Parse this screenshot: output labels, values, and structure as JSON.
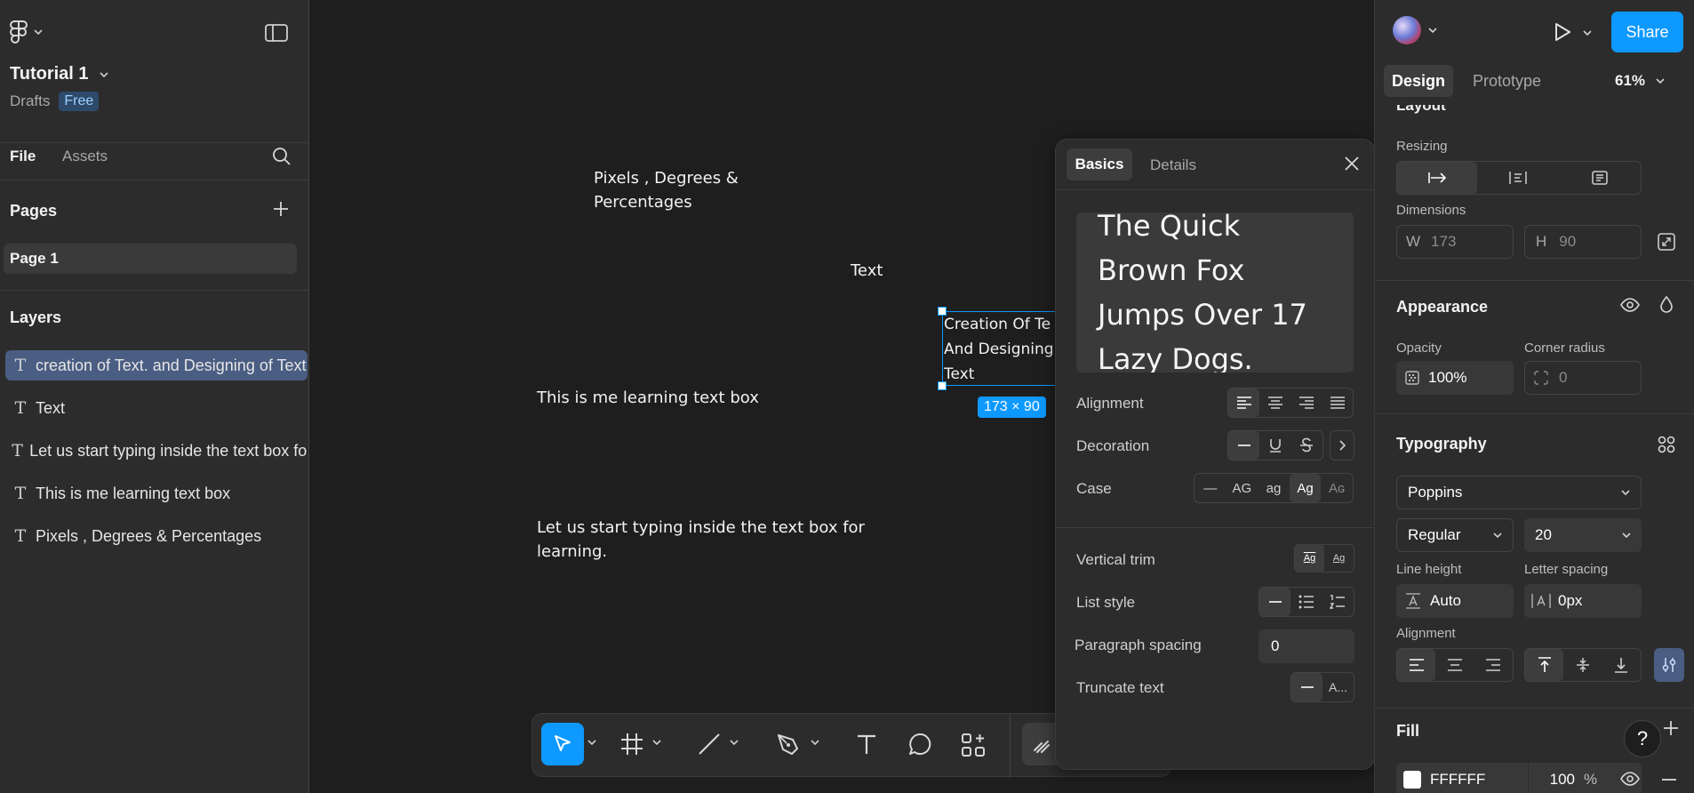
{
  "left": {
    "file_name": "Tutorial 1",
    "drafts_label": "Drafts",
    "plan_badge": "Free",
    "tabs": [
      "File",
      "Assets"
    ],
    "pages_title": "Pages",
    "pages": [
      "Page 1"
    ],
    "layers_title": "Layers",
    "layers": [
      "creation of Text. and Designing of Text",
      "Text",
      "Let us start typing inside the text box for learning.",
      "This is me learning text box",
      "Pixels , Degrees & Percentages"
    ]
  },
  "canvas": {
    "text_pixels_line1": "Pixels , Degrees &",
    "text_pixels_line2": "Percentages",
    "text_plain": "Text",
    "text_learning": "This is me learning text box",
    "text_typing_line1": "Let us start typing inside the text box for",
    "text_typing_line2": "learning.",
    "selected_line1": "Creation Of Te",
    "selected_line2": "And Designing",
    "selected_line3": "Text",
    "dimension_badge": "173 × 90"
  },
  "type_panel": {
    "tabs": [
      "Basics",
      "Details"
    ],
    "preview_lines": [
      "The Quick",
      "Brown Fox",
      "Jumps Over 17",
      "Lazy Dogs."
    ],
    "alignment_label": "Alignment",
    "decoration_label": "Decoration",
    "case_label": "Case",
    "case_options": [
      "—",
      "AG",
      "ag",
      "Ag",
      "Aɢ"
    ],
    "vertical_trim_label": "Vertical trim",
    "list_style_label": "List style",
    "paragraph_spacing_label": "Paragraph spacing",
    "paragraph_spacing_value": "0",
    "truncate_label": "Truncate text",
    "truncate_option": "A..."
  },
  "right": {
    "share_label": "Share",
    "tabs": [
      "Design",
      "Prototype"
    ],
    "zoom": "61%",
    "layout_partial": "Layout",
    "resizing_label": "Resizing",
    "dimensions_label": "Dimensions",
    "w_label": "W",
    "w_value": "173",
    "h_label": "H",
    "h_value": "90",
    "appearance_title": "Appearance",
    "opacity_label": "Opacity",
    "opacity_value": "100%",
    "corner_radius_label": "Corner radius",
    "corner_radius_value": "0",
    "typography_title": "Typography",
    "font_family": "Poppins",
    "font_weight": "Regular",
    "font_size": "20",
    "line_height_label": "Line height",
    "line_height_value": "Auto",
    "letter_spacing_label": "Letter spacing",
    "letter_spacing_value": "0px",
    "alignment_label": "Alignment",
    "fill_title": "Fill",
    "fill_hex": "FFFFFF",
    "fill_opacity": "100",
    "fill_percent": "%",
    "help": "?"
  },
  "colors": {
    "accent": "#0d99ff",
    "panel": "#2c2c2c",
    "canvas": "#1e1e1e"
  }
}
